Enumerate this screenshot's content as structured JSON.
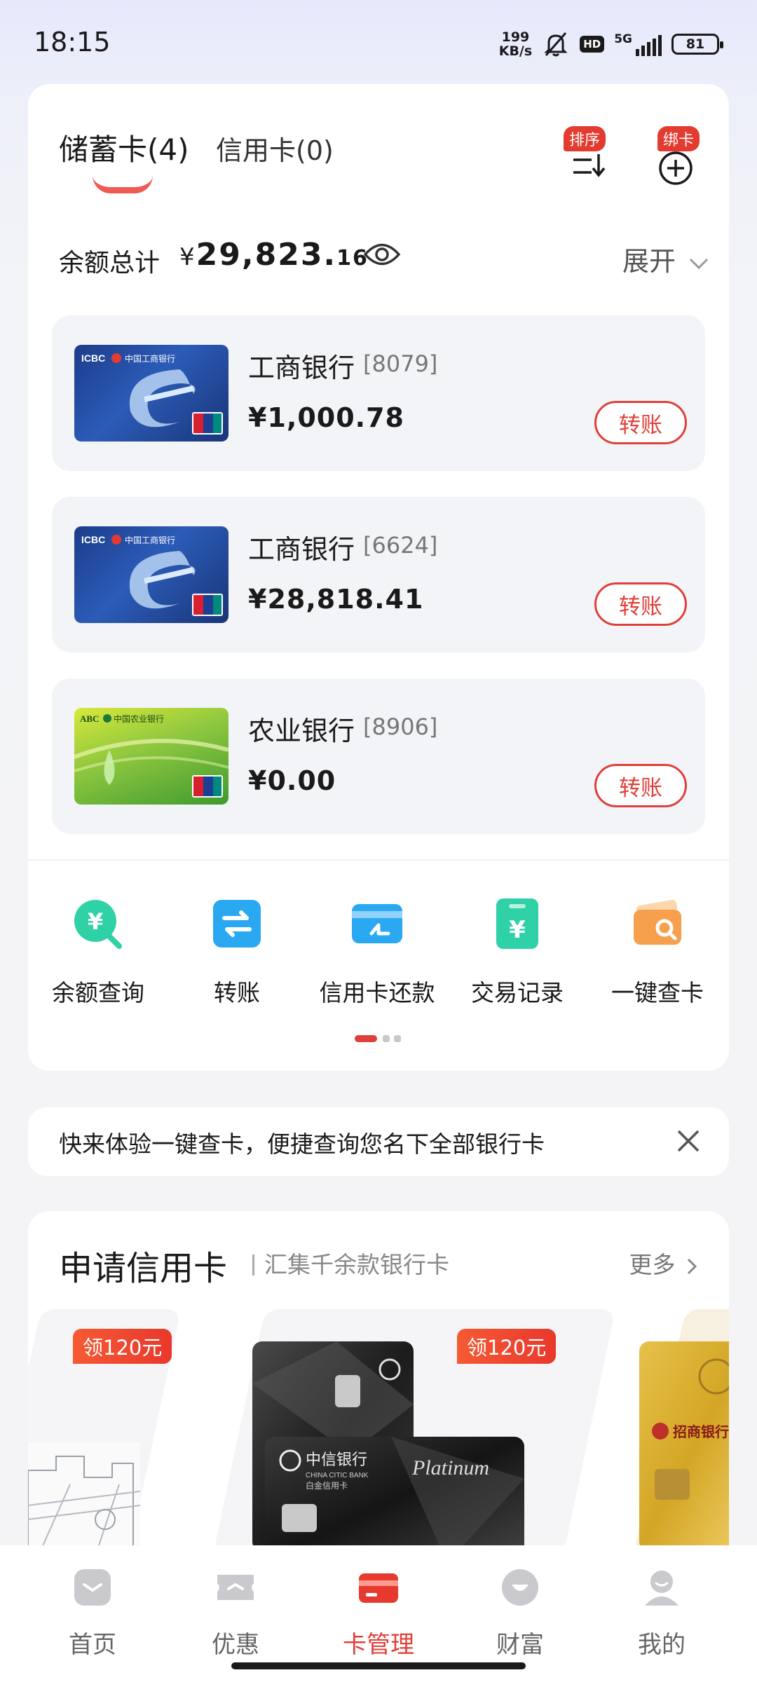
{
  "status_bar": {
    "time": "18:15",
    "net_speed_value": "199",
    "net_speed_unit": "KB/s",
    "hd": "HD",
    "network": "5G",
    "battery": "81"
  },
  "tabs": {
    "debit": "储蓄卡(4)",
    "credit": "信用卡(0)"
  },
  "header_actions": {
    "sort_badge": "排序",
    "bind_badge": "绑卡"
  },
  "balance": {
    "label": "余额总计",
    "currency": "¥",
    "integer": "29,823.",
    "decimal": "16",
    "expand": "展开"
  },
  "accounts": [
    {
      "bank": "工商银行",
      "number": "[8079]",
      "balance": "¥1,000.78",
      "action": "转账",
      "card_brand": "ICBC",
      "card_bank_cn": "中国工商银行"
    },
    {
      "bank": "工商银行",
      "number": "[6624]",
      "balance": "¥28,818.41",
      "action": "转账",
      "card_brand": "ICBC",
      "card_bank_cn": "中国工商银行"
    },
    {
      "bank": "农业银行",
      "number": "[8906]",
      "balance": "¥0.00",
      "action": "转账",
      "card_brand": "ABC",
      "card_bank_cn": "中国农业银行"
    }
  ],
  "quick_actions": [
    {
      "label": "余额查询",
      "icon": "balance-query-icon",
      "color": "#2fd1a6"
    },
    {
      "label": "转账",
      "icon": "transfer-icon",
      "color": "#2aa8f2"
    },
    {
      "label": "信用卡还款",
      "icon": "credit-repay-icon",
      "color": "#2aa8f2"
    },
    {
      "label": "交易记录",
      "icon": "transaction-record-icon",
      "color": "#2fd1a6"
    },
    {
      "label": "一键查卡",
      "icon": "card-lookup-icon",
      "color": "#f6a04d"
    }
  ],
  "promo": {
    "text": "快来体验一键查卡，便捷查询您名下全部银行卡"
  },
  "apply_card": {
    "title": "申请信用卡",
    "subtitle": "汇集千余款银行卡",
    "more": "更多",
    "offers": [
      {
        "badge": "领120元"
      },
      {
        "badge": "领120元"
      }
    ],
    "citic_name": "中信银行",
    "citic_en": "CHINA CITIC BANK",
    "citic_type": "白金信用卡",
    "citic_script": "Platinum",
    "cmb_name": "招商银行"
  },
  "bottom_nav": [
    {
      "label": "首页",
      "active": false
    },
    {
      "label": "优惠",
      "active": false
    },
    {
      "label": "卡管理",
      "active": true
    },
    {
      "label": "财富",
      "active": false
    },
    {
      "label": "我的",
      "active": false
    }
  ],
  "colors": {
    "accent": "#e0403a",
    "teal": "#2fd1a6",
    "blue": "#2aa8f2",
    "orange": "#f6a04d"
  }
}
